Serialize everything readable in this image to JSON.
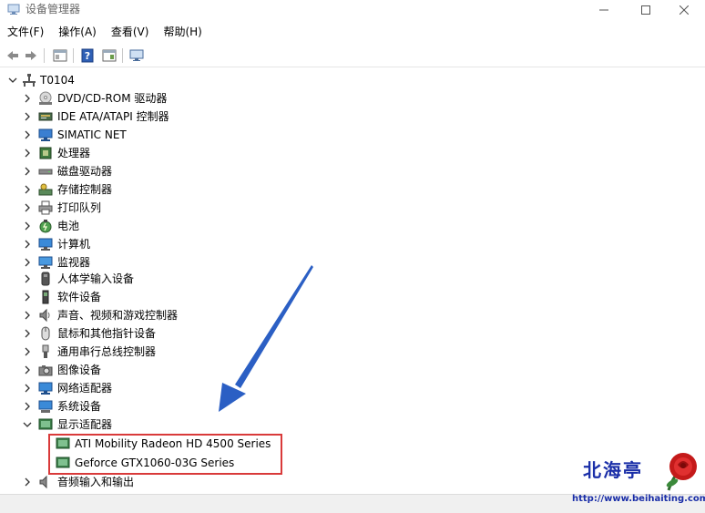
{
  "window": {
    "title": "设备管理器"
  },
  "menu": [
    {
      "label": "文件(F)"
    },
    {
      "label": "操作(A)"
    },
    {
      "label": "查看(V)"
    },
    {
      "label": "帮助(H)"
    }
  ],
  "tree": {
    "root": {
      "label": "T0104",
      "icon": "computer-root-icon",
      "expanded": true
    },
    "categories": [
      {
        "label": "DVD/CD-ROM 驱动器",
        "icon": "dvd-drive-icon"
      },
      {
        "label": "IDE ATA/ATAPI 控制器",
        "icon": "ide-controller-icon"
      },
      {
        "label": "SIMATIC NET",
        "icon": "network-adapter-icon"
      },
      {
        "label": "处理器",
        "icon": "processor-icon"
      },
      {
        "label": "磁盘驱动器",
        "icon": "disk-drive-icon"
      },
      {
        "label": "存储控制器",
        "icon": "storage-controller-icon"
      },
      {
        "label": "打印队列",
        "icon": "printer-icon"
      },
      {
        "label": "电池",
        "icon": "battery-icon"
      },
      {
        "label": "计算机",
        "icon": "computer-icon"
      },
      {
        "label": "监视器",
        "icon": "monitor-icon"
      },
      {
        "label": "人体学输入设备",
        "icon": "hid-icon"
      },
      {
        "label": "软件设备",
        "icon": "software-device-icon"
      },
      {
        "label": "声音、视频和游戏控制器",
        "icon": "sound-icon"
      },
      {
        "label": "鼠标和其他指针设备",
        "icon": "mouse-icon"
      },
      {
        "label": "通用串行总线控制器",
        "icon": "usb-icon"
      },
      {
        "label": "图像设备",
        "icon": "camera-icon"
      },
      {
        "label": "网络适配器",
        "icon": "network-icon"
      },
      {
        "label": "系统设备",
        "icon": "system-device-icon"
      },
      {
        "label": "显示适配器",
        "icon": "display-adapter-icon",
        "expanded": true
      }
    ],
    "display_adapters": [
      {
        "label": "ATI Mobility Radeon HD 4500 Series"
      },
      {
        "label": "Geforce GTX1060-03G Series"
      }
    ],
    "last_category": {
      "label": "音频输入和输出",
      "icon": "audio-io-icon"
    }
  },
  "watermark": {
    "text": "北海亭",
    "url": "http://www.beihaiting.com"
  },
  "colors": {
    "highlight_border": "#d93a3a",
    "arrow": "#2b5fc4",
    "watermark": "#1a2ea8"
  }
}
